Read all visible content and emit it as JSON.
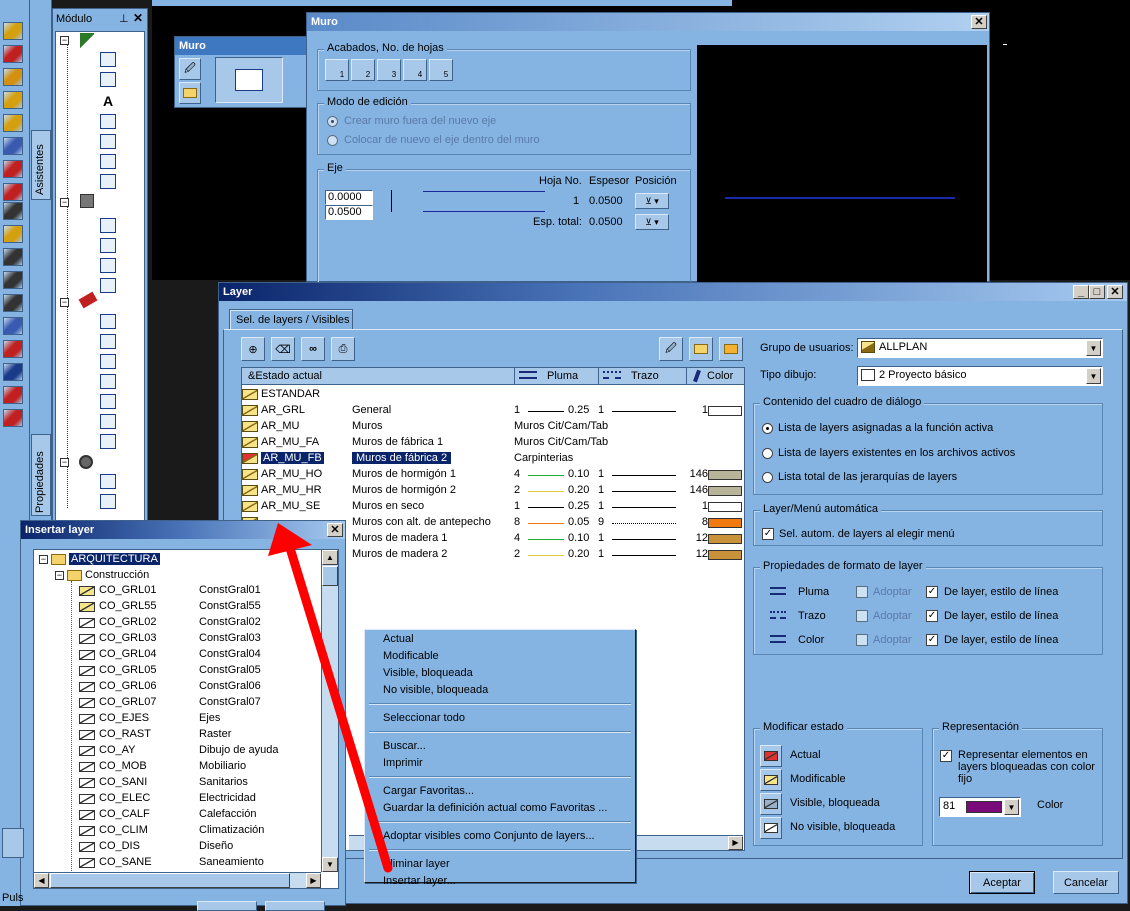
{
  "colors": {
    "panel": "#86b4e2",
    "title_dark": "#0a246a",
    "accent_red": "#ff0000"
  },
  "left_toolbar": {
    "items": [
      "wall-icon",
      "pen-icon",
      "stair-icon",
      "ramp-icon",
      "step-icon",
      "grid-icon",
      "roof-icon",
      "text-icon",
      "dimension-icon",
      "assist-icon",
      "binoculars-icon",
      "list-icon",
      "hatch-icon",
      "section-icon",
      "column-icon",
      "arc-icon",
      "door-icon",
      "window-icon"
    ]
  },
  "side_tabs": {
    "asistentes": "Asistentes",
    "propiedades": "Propiedades"
  },
  "modulo": {
    "title": "Módulo",
    "pin": "⊥",
    "close": "✕"
  },
  "status": {
    "puls": "Puls"
  },
  "muro": {
    "title": "Muro",
    "acabados_title": "Acabados, No. de hojas",
    "acabados_buttons": [
      "1",
      "2",
      "3",
      "4",
      "5"
    ],
    "modo_title": "Modo de edición",
    "modo_opt1": "Crear muro fuera del nuevo eje",
    "modo_opt2": "Colocar de nuevo el eje dentro del muro",
    "eje_title": "Eje",
    "eje_val1": "0.0000",
    "eje_val2": "0.0500",
    "hoja_header": "Hoja No.",
    "espesor_header": "Espesor",
    "posicion_header": "Posición",
    "hoja_no": "1",
    "espesor": "0.0500",
    "esp_total_label": "Esp. total:",
    "esp_total": "0.0500"
  },
  "muro_small": {
    "title": "Muro"
  },
  "layer": {
    "title": "Layer",
    "tab": "Sel. de layers / Visibles",
    "col_estado": "&Estado actual",
    "col_pluma": "Pluma",
    "col_trazo": "Trazo",
    "col_color": "Color",
    "rows": [
      {
        "name": "ESTANDAR",
        "desc": "",
        "p1": "",
        "p2": "",
        "p3": "",
        "p4": "",
        "sel": false
      },
      {
        "name": "AR_GRL",
        "desc": "General",
        "p1": "1",
        "p2": "0.25",
        "p3": "1",
        "p4": "1",
        "sel": false
      },
      {
        "name": "AR_MU",
        "desc": "Muros",
        "p1": "Muros Cit/Cam/Tab",
        "p2": "",
        "p3": "",
        "p4": "",
        "sel": false
      },
      {
        "name": "AR_MU_FA",
        "desc": "Muros de fábrica 1",
        "p1": "Muros Cit/Cam/Tab",
        "p2": "",
        "p3": "",
        "p4": "",
        "sel": false
      },
      {
        "name": "AR_MU_FB",
        "desc": "Muros de fábrica 2",
        "p1": "Carpinterias",
        "p2": "",
        "p3": "",
        "p4": "",
        "sel": true
      },
      {
        "name": "AR_MU_HO",
        "desc": "Muros de hormigón 1",
        "p1": "4",
        "p2": "0.10",
        "p3": "1",
        "p4": "146",
        "sel": false
      },
      {
        "name": "AR_MU_HR",
        "desc": "Muros de hormigón 2",
        "p1": "2",
        "p2": "0.20",
        "p3": "1",
        "p4": "146",
        "sel": false
      },
      {
        "name": "AR_MU_SE",
        "desc": "Muros en seco",
        "p1": "1",
        "p2": "0.25",
        "p3": "1",
        "p4": "1",
        "sel": false
      },
      {
        "name": "",
        "desc": "Muros con alt. de antepecho",
        "p1": "8",
        "p2": "0.05",
        "p3": "9",
        "p4": "8",
        "sel": false
      },
      {
        "name": "",
        "desc": "Muros de madera 1",
        "p1": "4",
        "p2": "0.10",
        "p3": "1",
        "p4": "12",
        "sel": false
      },
      {
        "name": "",
        "desc": "Muros de madera 2",
        "p1": "2",
        "p2": "0.20",
        "p3": "1",
        "p4": "12",
        "sel": false
      }
    ],
    "grupo_label": "Grupo de usuarios:",
    "grupo_value": "ALLPLAN",
    "tipo_label": "Tipo dibujo:",
    "tipo_value": "2 Proyecto básico",
    "contenido_title": "Contenido del cuadro de diálogo",
    "contenido_opts": [
      "Lista de layers asignadas a la función activa",
      "Lista de layers existentes en los archivos activos",
      "Lista total de las  jerarquías de layers"
    ],
    "auto_title": "Layer/Menú automática",
    "auto_opt": "Sel. autom. de layers al elegir menú",
    "prop_title": "Propiedades de formato de layer",
    "prop_rows": [
      {
        "label": "Pluma",
        "adoptar": "Adoptar",
        "de_layer": "De layer, estilo de línea"
      },
      {
        "label": "Trazo",
        "adoptar": "Adoptar",
        "de_layer": "De layer, estilo de línea"
      },
      {
        "label": "Color",
        "adoptar": "Adoptar",
        "de_layer": "De layer, estilo de línea"
      }
    ],
    "mod_title": "Modificar estado",
    "mod_items": [
      "Actual",
      "Modificable",
      "Visible, bloqueada",
      "No visible, bloqueada"
    ],
    "rep_title": "Representación",
    "rep_opt": "Representar elementos en layers bloqueadas con color fijo",
    "rep_color_num": "81",
    "rep_color_label": "Color",
    "aceptar": "Aceptar",
    "cancelar": "Cancelar"
  },
  "context_menu": {
    "g1": [
      "Actual",
      "Modificable",
      "Visible, bloqueada",
      "No visible, bloqueada"
    ],
    "g2": [
      "Seleccionar todo"
    ],
    "g3": [
      "Buscar...",
      "Imprimir"
    ],
    "g4": [
      "Cargar Favoritas...",
      "Guardar la definición actual como Favoritas ..."
    ],
    "g5": [
      "Adoptar visibles como Conjunto de layers..."
    ],
    "g6": [
      "Eliminar layer",
      "Insertar layer..."
    ]
  },
  "insertar": {
    "title": "Insertar layer",
    "root": "ARQUITECTURA",
    "sub": "Construcción",
    "items": [
      {
        "code": "CO_GRL01",
        "desc": "ConstGral01"
      },
      {
        "code": "CO_GRL55",
        "desc": "ConstGral55"
      },
      {
        "code": "CO_GRL02",
        "desc": "ConstGral02"
      },
      {
        "code": "CO_GRL03",
        "desc": "ConstGral03"
      },
      {
        "code": "CO_GRL04",
        "desc": "ConstGral04"
      },
      {
        "code": "CO_GRL05",
        "desc": "ConstGral05"
      },
      {
        "code": "CO_GRL06",
        "desc": "ConstGral06"
      },
      {
        "code": "CO_GRL07",
        "desc": "ConstGral07"
      },
      {
        "code": "CO_EJES",
        "desc": "Ejes"
      },
      {
        "code": "CO_RAST",
        "desc": "Raster"
      },
      {
        "code": "CO_AY",
        "desc": "Dibujo de ayuda"
      },
      {
        "code": "CO_MOB",
        "desc": "Mobiliario"
      },
      {
        "code": "CO_SANI",
        "desc": "Sanitarios"
      },
      {
        "code": "CO_ELEC",
        "desc": "Electricidad"
      },
      {
        "code": "CO_CALF",
        "desc": "Calefacción"
      },
      {
        "code": "CO_CLIM",
        "desc": "Climatización"
      },
      {
        "code": "CO_DIS",
        "desc": "Diseño"
      },
      {
        "code": "CO_SANE",
        "desc": "Saneamiento"
      }
    ]
  }
}
